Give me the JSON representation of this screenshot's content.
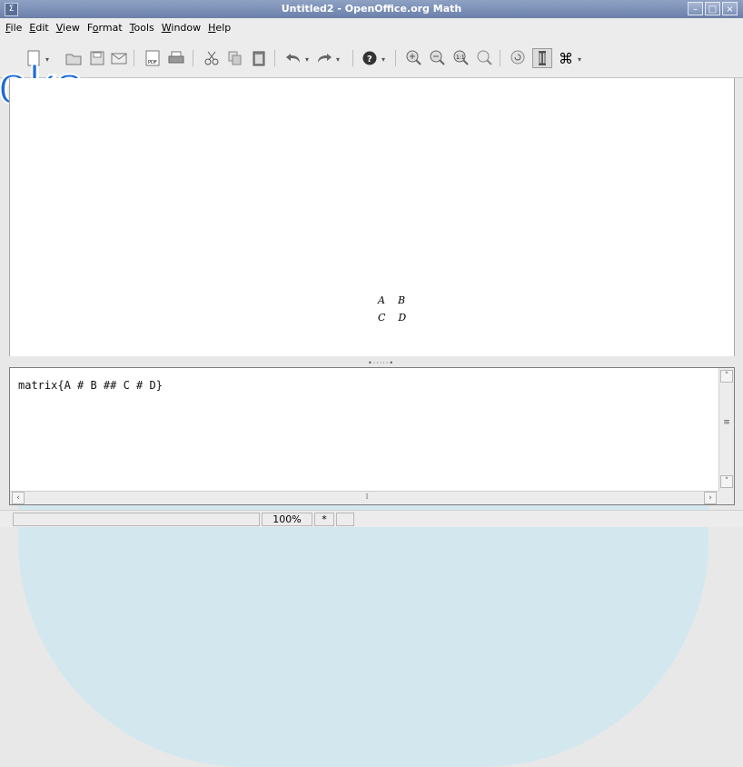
{
  "window": {
    "title": "Untitled2 - OpenOffice.org Math",
    "app_icon": "Σ",
    "controls": [
      "minimize-icon",
      "maximize-icon",
      "close-icon"
    ]
  },
  "menubar": {
    "items": [
      {
        "u": "F",
        "rest": "ile"
      },
      {
        "u": "E",
        "rest": "dit"
      },
      {
        "u": "V",
        "rest": "iew"
      },
      {
        "u": "o",
        "pre": "F",
        "rest": "rmat"
      },
      {
        "u": "T",
        "rest": "ools"
      },
      {
        "u": "W",
        "rest": "indow"
      },
      {
        "u": "H",
        "rest": "elp"
      }
    ]
  },
  "toolbar": {
    "icons": [
      "new-icon",
      "open-icon",
      "save-icon",
      "email-icon",
      "export-pdf-icon",
      "print-icon",
      "cut-icon",
      "copy-icon",
      "paste-icon",
      "undo-icon",
      "redo-icon",
      "help-icon",
      "zoom-in-icon",
      "zoom-out-icon",
      "zoom-100-icon",
      "show-all-icon",
      "update-icon",
      "formula-cursor-icon",
      "symbols-icon"
    ]
  },
  "watermark": {
    "text": "oks"
  },
  "preview": {
    "matrix": [
      [
        "A",
        "B"
      ],
      [
        "C",
        "D"
      ]
    ]
  },
  "editor": {
    "content": "matrix{A # B ## C # D}"
  },
  "statusbar": {
    "zoom": "100%",
    "modified": "*"
  },
  "colors": {
    "titlebar": "#7d91b8",
    "watermark": "#1d6bd9",
    "overlay": "#c3e8f2"
  }
}
